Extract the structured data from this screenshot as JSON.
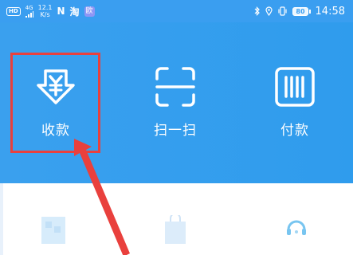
{
  "status_bar": {
    "hd_badge": "HD",
    "network": "4G",
    "speed_value": "12.1",
    "speed_unit": "K/s",
    "nfc_glyph": "N",
    "app_glyph_1": "淘",
    "app_glyph_2": "欧",
    "battery": "80",
    "time": "14:58"
  },
  "header": {
    "actions": [
      {
        "label": "收款",
        "icon": "receive-money-icon"
      },
      {
        "label": "扫一扫",
        "icon": "scan-icon"
      },
      {
        "label": "付款",
        "icon": "pay-barcode-icon"
      }
    ]
  },
  "annotations": {
    "highlight_color": "#e9403d",
    "arrow_color": "#e9403d"
  },
  "colors": {
    "header_blue": "#3aa0ee",
    "white": "#ffffff"
  }
}
